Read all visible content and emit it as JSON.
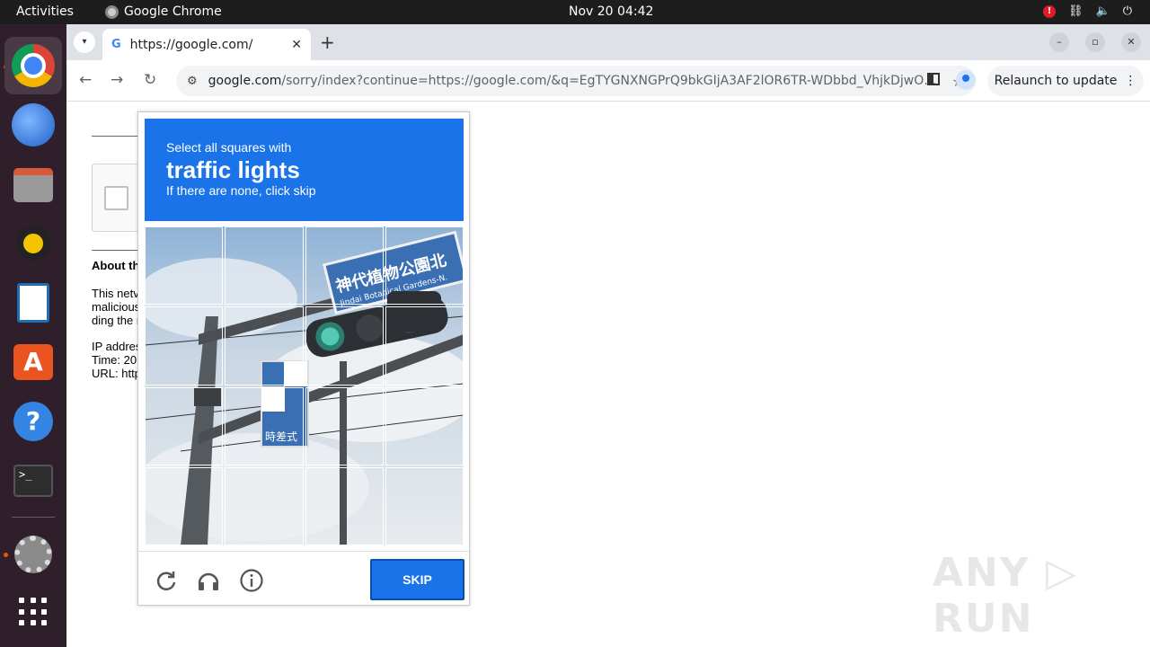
{
  "topbar": {
    "activities": "Activities",
    "app_name": "Google Chrome",
    "clock": "Nov 20  04:42",
    "alert": "!"
  },
  "dock": {
    "items": [
      "chrome-icon",
      "thunderbird-icon",
      "files-icon",
      "rhythmbox-icon",
      "writer-icon",
      "app-center-icon",
      "help-icon",
      "terminal-icon",
      "settings-icon",
      "show-apps-icon"
    ],
    "terminal_prompt": ">_",
    "store_glyph": "A",
    "help_glyph": "?"
  },
  "browser": {
    "tab_title": "https://google.com/",
    "tab_favicon": "G",
    "url_host": "google.com",
    "url_rest": "/sorry/index?continue=https://google.com/&q=EgTYGNXNGPrQ9bkGIjA3AF2lOR6TR-WDbbd_VhjkDjwO…",
    "relaunch_label": "Relaunch to update",
    "relaunch_menu": "⋮"
  },
  "page": {
    "about": "About th",
    "para_lines": [
      "This netv",
      "malicious",
      "ding the r"
    ],
    "meta_lines": [
      "IP addres",
      "Time: 20",
      "URL: http"
    ]
  },
  "captcha": {
    "instruction": "Select all squares with",
    "target": "traffic lights",
    "hint": "If there are none, click skip",
    "sign_text": "神代植物公園北",
    "sign_subtext": "Jindai Botanical Gardens-N.",
    "small_sign_text": "時差式",
    "grid_rows": 4,
    "grid_cols": 4,
    "skip_label": "SKIP",
    "footer_icons": [
      "reload-icon",
      "audio-icon",
      "info-icon"
    ]
  },
  "watermark": "ANY ▷ RUN",
  "colors": {
    "accent_blue": "#1a73e8",
    "dock_bg": "#2f1f2a",
    "topbar_bg": "#1d1d1d"
  }
}
